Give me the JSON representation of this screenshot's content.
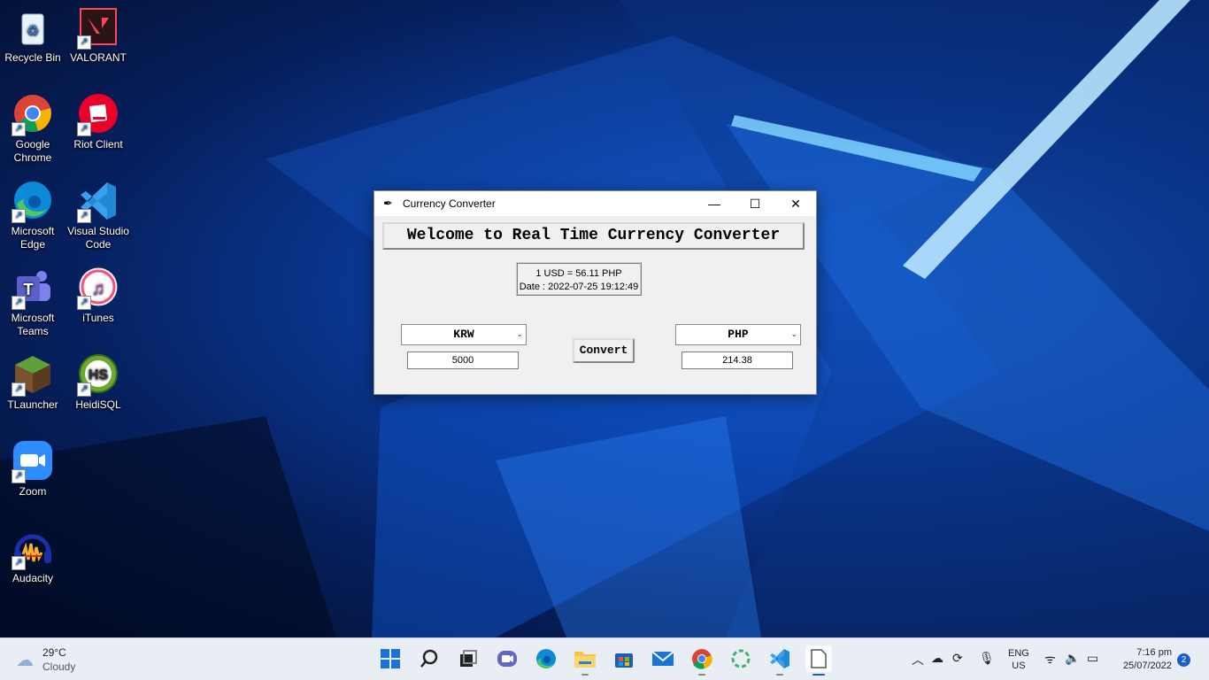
{
  "desktop_icons": [
    {
      "label": "Recycle Bin",
      "icon": "recycle-bin-icon",
      "color": "#c9e3f7"
    },
    {
      "label": "VALORANT",
      "icon": "valorant-icon",
      "color": "#ff4655"
    },
    {
      "label": "Google Chrome",
      "icon": "chrome-icon",
      "color": "#4285f4"
    },
    {
      "label": "Riot Client",
      "icon": "riot-client-icon",
      "color": "#eb0029"
    },
    {
      "label": "Microsoft Edge",
      "icon": "edge-icon",
      "color": "#0c8ad8"
    },
    {
      "label": "Visual Studio Code",
      "icon": "vscode-icon",
      "color": "#1e8ad6"
    },
    {
      "label": "Microsoft Teams",
      "icon": "teams-icon",
      "color": "#5b5fc7"
    },
    {
      "label": "iTunes",
      "icon": "itunes-icon",
      "color": "#f94c7c"
    },
    {
      "label": "TLauncher",
      "icon": "tlauncher-icon",
      "color": "#5f9f3c"
    },
    {
      "label": "HeidiSQL",
      "icon": "heidisql-icon",
      "color": "#6aa82f"
    },
    {
      "label": "Zoom",
      "icon": "zoom-icon",
      "color": "#2d8cff"
    },
    {
      "label": "Audacity",
      "icon": "audacity-icon",
      "color": "#f9b12b"
    }
  ],
  "window": {
    "title": "Currency Converter",
    "minimize_glyph": "—",
    "maximize_glyph": "☐",
    "close_glyph": "✕",
    "welcome": "Welcome to Real Time Currency Converter",
    "rate_line": "1 USD = 56.11 PHP",
    "date_line": "Date : 2022-07-25 19:12:49",
    "from_currency": "KRW",
    "to_currency": "PHP",
    "from_amount": "5000",
    "to_amount": "214.38",
    "convert_label": "Convert"
  },
  "taskbar": {
    "weather_temp": "29°C",
    "weather_desc": "Cloudy",
    "apps": [
      "start-icon",
      "search-icon",
      "task-view-icon",
      "teams-chat-icon",
      "edge-icon",
      "file-explorer-icon",
      "store-icon",
      "mail-icon",
      "chrome-icon",
      "spinner-app-icon",
      "vscode-icon",
      "notepad-icon"
    ],
    "lang_top": "ENG",
    "lang_bottom": "US",
    "time": "7:16 pm",
    "date": "25/07/2022",
    "notification_count": "2"
  }
}
